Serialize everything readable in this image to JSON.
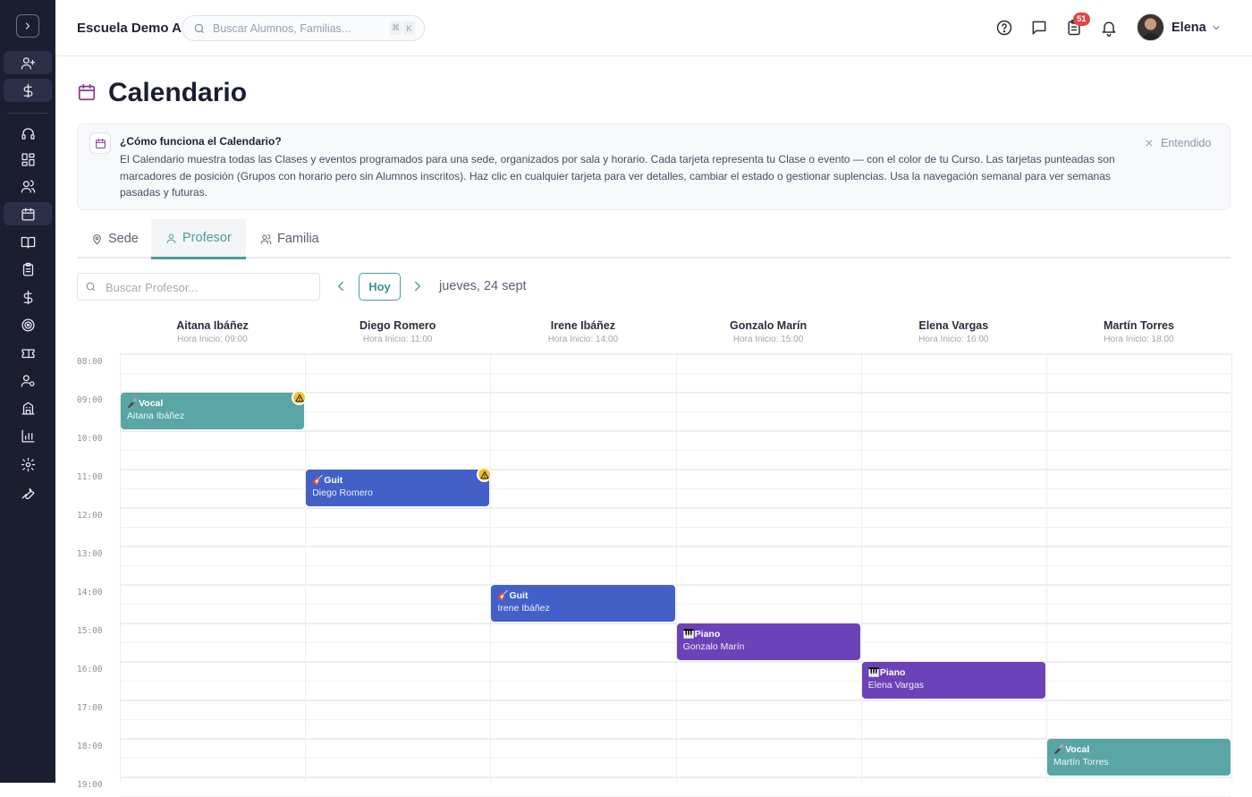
{
  "header": {
    "school_name": "Escuela Demo A",
    "search_placeholder": "Buscar Alumnos, Familias...",
    "kbd_cmd": "⌘",
    "kbd_k": "K",
    "tasks_badge": "51",
    "user_name": "Elena"
  },
  "page": {
    "title": "Calendario"
  },
  "info": {
    "title": "¿Cómo funciona el Calendario?",
    "text": "El Calendario muestra todas las Clases y eventos programados para una sede, organizados por sala y horario. Cada tarjeta representa tu Clase o evento — con el color de tu Curso. Las tarjetas punteadas son marcadores de posición (Grupos con horario pero sin Alumnos inscritos). Haz clic en cualquier tarjeta para ver detalles, cambiar el estado o gestionar suplencias. Usa la navegación semanal para ver semanas pasadas y futuras.",
    "dismiss_label": "Entendido"
  },
  "tabs": [
    {
      "label": "Sede",
      "icon": "map-pin-icon",
      "active": false
    },
    {
      "label": "Profesor",
      "icon": "user-icon",
      "active": true
    },
    {
      "label": "Familia",
      "icon": "users-icon",
      "active": false
    }
  ],
  "toolbar": {
    "search_placeholder": "Buscar Profesor...",
    "today_label": "Hoy",
    "date_label": "jueves, 24 sept"
  },
  "calendar": {
    "columns": [
      {
        "name": "Aitana Ibáñez",
        "start": "Hora Inicio: 09:00"
      },
      {
        "name": "Diego Romero",
        "start": "Hora Inicio: 11:00"
      },
      {
        "name": "Irene Ibáñez",
        "start": "Hora Inicio: 14:00"
      },
      {
        "name": "Gonzalo Marín",
        "start": "Hora Inicio: 15:00"
      },
      {
        "name": "Elena Vargas",
        "start": "Hora Inicio: 16:00"
      },
      {
        "name": "Martín Torres",
        "start": "Hora Inicio: 18:00"
      }
    ],
    "times": [
      "08:00",
      "09:00",
      "10:00",
      "11:00",
      "12:00",
      "13:00",
      "14:00",
      "15:00",
      "16:00",
      "17:00",
      "18:00",
      "19:00"
    ],
    "events": [
      {
        "title": "🎤Vocal",
        "teacher": "Aitana Ibáñez",
        "color": "#5aa5a5",
        "warning": true,
        "column": "Aitana Ibáñez",
        "start": "09:00"
      },
      {
        "title": "🎸Guit",
        "teacher": "Diego Romero",
        "color": "#4360c9",
        "warning": true,
        "column": "Diego Romero",
        "start": "11:00"
      },
      {
        "title": "🎸Guit",
        "teacher": "Irene Ibáñez",
        "color": "#4360c9",
        "warning": false,
        "column": "Irene Ibáñez",
        "start": "14:00"
      },
      {
        "title": "🎹Piano",
        "teacher": "Gonzalo Marín",
        "color": "#6c42b8",
        "warning": false,
        "column": "Gonzalo Marín",
        "start": "15:00"
      },
      {
        "title": "🎹Piano",
        "teacher": "Elena Vargas",
        "color": "#6c42b8",
        "warning": false,
        "column": "Elena Vargas",
        "start": "16:00"
      },
      {
        "title": "🎤Vocal",
        "teacher": "Martín Torres",
        "color": "#5aa5a5",
        "warning": false,
        "column": "Martín Torres",
        "start": "18:00"
      }
    ]
  },
  "colors": {
    "sidebar_bg": "#1b1d31",
    "accent_teal": "#4d9c9a",
    "title_icon": "#8b3a8f",
    "badge_red": "#e24545"
  }
}
